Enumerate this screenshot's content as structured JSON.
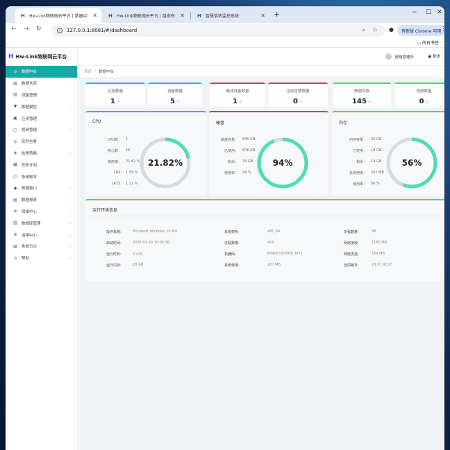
{
  "browser": {
    "tabs": [
      {
        "title": "Hw-Link物联网云平台 | 数据中",
        "active": true
      },
      {
        "title": "Hw-Link物联网云平台 | 组态布",
        "active": false
      },
      {
        "title": "智慧供热监控系统",
        "active": false
      }
    ],
    "url": "127.0.0.1:8081/#/dashboard",
    "profile_badge": "有新版 Chrome 可用",
    "bookmarks_all": "所有书签"
  },
  "app": {
    "logo": "Hw-Link物联网云平台",
    "logo_mark": "H",
    "user": "超级管理员",
    "theme": "整体",
    "breadcrumb": {
      "home": "首页",
      "sep": "/",
      "current": "数据中台"
    }
  },
  "sidebar": {
    "items": [
      {
        "label": "数据中台",
        "icon": "dashboard-icon",
        "glyph": "⊙",
        "active": true,
        "chev": ""
      },
      {
        "label": "数据仓库",
        "icon": "database-icon",
        "glyph": "▤",
        "active": false,
        "chev": ""
      },
      {
        "label": "设备管理",
        "icon": "device-icon",
        "glyph": "▥",
        "active": false,
        "chev": ""
      },
      {
        "label": "数据模型",
        "icon": "model-icon",
        "glyph": "▼",
        "active": false,
        "chev": "⌄"
      },
      {
        "label": "应用管理",
        "icon": "app-icon",
        "glyph": "▣",
        "active": false,
        "chev": ""
      },
      {
        "label": "视频管理",
        "icon": "video-icon",
        "glyph": "▢",
        "active": false,
        "chev": "⌄"
      },
      {
        "label": "实时告警",
        "icon": "alarm-icon",
        "glyph": "◎",
        "active": false,
        "chev": ""
      },
      {
        "label": "告警策略",
        "icon": "strategy-icon",
        "glyph": "◈",
        "active": false,
        "chev": "⌄"
      },
      {
        "label": "任务计划",
        "icon": "calendar-icon",
        "glyph": "▦",
        "active": false,
        "chev": ""
      },
      {
        "label": "系统脚本",
        "icon": "script-icon",
        "glyph": "◫",
        "active": false,
        "chev": ""
      },
      {
        "label": "数据接口",
        "icon": "api-icon",
        "glyph": "◆",
        "active": false,
        "chev": "⌄"
      },
      {
        "label": "数据报表",
        "icon": "report-icon",
        "glyph": "▤",
        "active": false,
        "chev": "⌄"
      },
      {
        "label": "网络中心",
        "icon": "network-icon",
        "glyph": "⊕",
        "active": false,
        "chev": "⌄"
      },
      {
        "label": "数据库管理",
        "icon": "db-admin-icon",
        "glyph": "▥",
        "active": false,
        "chev": "⌄"
      },
      {
        "label": "运维中心",
        "icon": "ops-icon",
        "glyph": "⊛",
        "active": false,
        "chev": "⌄"
      },
      {
        "label": "系统日志",
        "icon": "log-icon",
        "glyph": "▧",
        "active": false,
        "chev": "⌄"
      },
      {
        "label": "帮助",
        "icon": "help-icon",
        "glyph": "⊙",
        "active": false,
        "chev": "⌄"
      }
    ]
  },
  "stats": [
    {
      "label": "应用数量",
      "value": "1",
      "unit": "个",
      "color": "#3fa9e0"
    },
    {
      "label": "设备数量",
      "value": "5",
      "unit": "个",
      "color": "#3fa9e0"
    },
    {
      "label": "离线设备数量",
      "value": "1",
      "unit": "个",
      "color": "#d6336c"
    },
    {
      "label": "当前告警数量",
      "value": "0",
      "unit": "个",
      "color": "#d6336c"
    },
    {
      "label": "数据点数",
      "value": "145",
      "unit": "个",
      "color": "#5bd06a"
    },
    {
      "label": "视频数量",
      "value": "0",
      "unit": "个",
      "color": "#5bd06a"
    }
  ],
  "cpu": {
    "title": "CPU",
    "color": "#3fa9e0",
    "rows": [
      {
        "k": "CPU数：",
        "v": "1"
      },
      {
        "k": "核心数：",
        "v": "16"
      },
      {
        "k": "使用率：",
        "v": "21.82 %"
      },
      {
        "k": "LA5:",
        "v": "1.59 %"
      },
      {
        "k": "LA15:",
        "v": "1.12 %"
      }
    ],
    "percent": 21.82,
    "label": "21.82%"
  },
  "disk": {
    "title": "硬盘",
    "color": "#d6336c",
    "rows": [
      {
        "k": "磁盘容量：",
        "v": "645 GB"
      },
      {
        "k": "已使用：",
        "v": "606 GB"
      },
      {
        "k": "剩余：",
        "v": "39 GB"
      },
      {
        "k": "使用率：",
        "v": "94 %"
      }
    ],
    "percent": 94,
    "label": "94%"
  },
  "memory": {
    "title": "内存",
    "color": "#5bd06a",
    "rows": [
      {
        "k": "内存容量：",
        "v": "32 GB"
      },
      {
        "k": "已使用：",
        "v": "18 GB"
      },
      {
        "k": "剩余：",
        "v": "14 GB"
      },
      {
        "k": "系统使用：",
        "v": "207 MB"
      },
      {
        "k": "使用率：",
        "v": "56 %"
      }
    ],
    "percent": 56,
    "label": "56%"
  },
  "runtime": {
    "title": "运行环境信息",
    "rows": [
      [
        {
          "k": "操作系统:",
          "v": "Microsoft Windows 10 Pro"
        },
        {
          "k": "系统架构:",
          "v": "x86_64"
        },
        {
          "k": "协程数量:",
          "v": "98"
        }
      ],
      [
        {
          "k": "启动时间:",
          "v": "2026-03-29 10:05:36"
        },
        {
          "k": "进程数量:",
          "v": "406"
        },
        {
          "k": "网络接收:",
          "v": "1160 MB"
        }
      ],
      [
        {
          "k": "运行时长:",
          "v": "2 小时"
        },
        {
          "k": "机器码:",
          "v": "6990633DFA813671"
        },
        {
          "k": "网络发送:",
          "v": "169 MB"
        }
      ],
      [
        {
          "k": "运行内存:",
          "v": "18 GB"
        },
        {
          "k": "系统使用:",
          "v": "207 MB"
        },
        {
          "k": "当前版本:",
          "v": "V3.01.RC07"
        }
      ]
    ]
  }
}
